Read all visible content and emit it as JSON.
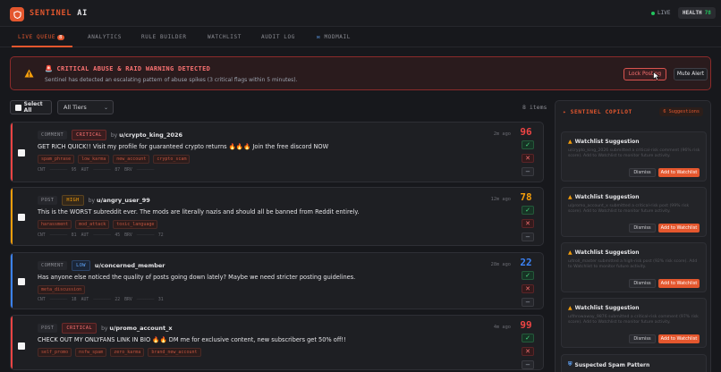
{
  "app": {
    "brand_a": "SENTINEL",
    "brand_b": "AI",
    "live_label": "LIVE",
    "health_label": "HEALTH",
    "health_value": "78"
  },
  "tabs": [
    {
      "label": "LIVE QUEUE",
      "count": "8",
      "active": true
    },
    {
      "label": "ANALYTICS"
    },
    {
      "label": "RULE BUILDER"
    },
    {
      "label": "WATCHLIST"
    },
    {
      "label": "AUDIT LOG"
    },
    {
      "label": "MODMAIL",
      "icon": "envelope-icon"
    }
  ],
  "alert": {
    "title": "CRITICAL ABUSE & RAID WARNING DETECTED",
    "description": "Sentinel has detected an escalating pattern of abuse spikes (3 critical flags within 5 minutes).",
    "lock_label": "Lock Posting",
    "mute_label": "Mute Alert"
  },
  "toolbar": {
    "select_all": "Select All",
    "tier_filter": "All Tiers",
    "item_count": "8 items"
  },
  "stats_labels": {
    "cnt": "CNT",
    "aut": "AUT",
    "brv": "BRV"
  },
  "queue": [
    {
      "type": "COMMENT",
      "tier": "CRITICAL",
      "tier_class": "critical",
      "by": "by",
      "user": "u/crypto_king_2026",
      "ago": "2m ago",
      "text": "GET RICH QUICK!! Visit my profile for guaranteed crypto returns 🔥🔥🔥 Join the free discord NOW",
      "tags": [
        "spam_phrase",
        "low_karma",
        "new_account",
        "crypto_scam"
      ],
      "cnt": "95",
      "aut": "87",
      "brv": "",
      "score": "96",
      "color": "#ef4444"
    },
    {
      "type": "POST",
      "tier": "HIGH",
      "tier_class": "high",
      "by": "by",
      "user": "u/angry_user_99",
      "ago": "12m ago",
      "text": "This is the WORST subreddit ever. The mods are literally nazis and should all be banned from Reddit entirely.",
      "tags": [
        "harassment",
        "mod_attack",
        "toxic_language"
      ],
      "cnt": "81",
      "aut": "45",
      "brv": "72",
      "score": "78",
      "color": "#f59e0b"
    },
    {
      "type": "COMMENT",
      "tier": "LOW",
      "tier_class": "low",
      "by": "by",
      "user": "u/concerned_member",
      "ago": "28m ago",
      "text": "Has anyone else noticed the quality of posts going down lately? Maybe we need stricter posting guidelines.",
      "tags": [
        "meta_discussion"
      ],
      "cnt": "18",
      "aut": "22",
      "brv": "31",
      "score": "22",
      "color": "#3b82f6"
    },
    {
      "type": "POST",
      "tier": "CRITICAL",
      "tier_class": "critical",
      "by": "by",
      "user": "u/promo_account_x",
      "ago": "4m ago",
      "text": "CHECK OUT MY ONLYFANS LINK IN BIO 🔥🔥 DM me for exclusive content, new subscribers get 50% off!!",
      "tags": [
        "self_promo",
        "nsfw_spam",
        "zero_karma",
        "brand_new_account"
      ],
      "cnt": "",
      "aut": "",
      "brv": "",
      "score": "99",
      "color": "#ef4444"
    }
  ],
  "copilot": {
    "title": "SENTINEL COPILOT",
    "badge": "6 Suggestions",
    "suggestions": [
      {
        "title": "Watchlist Suggestion",
        "desc": "u/crypto_king_2026 submitted a critical-risk comment (96% risk score). Add to Watchlist to monitor future activity.",
        "dismiss": "Dismiss",
        "add": "Add to Watchlist"
      },
      {
        "title": "Watchlist Suggestion",
        "desc": "u/promo_account_x submitted a critical-risk post (99% risk score). Add to Watchlist to monitor future activity.",
        "dismiss": "Dismiss",
        "add": "Add to Watchlist"
      },
      {
        "title": "Watchlist Suggestion",
        "desc": "u/troll_master submitted a high-risk post (92% risk score). Add to Watchlist to monitor future activity.",
        "dismiss": "Dismiss",
        "add": "Add to Watchlist"
      },
      {
        "title": "Watchlist Suggestion",
        "desc": "u/throwaway_9876 submitted a critical-risk comment (97% risk score). Add to Watchlist to monitor future activity.",
        "dismiss": "Dismiss",
        "add": "Add to Watchlist"
      }
    ],
    "last_title": "Suspected Spam Pattern"
  }
}
